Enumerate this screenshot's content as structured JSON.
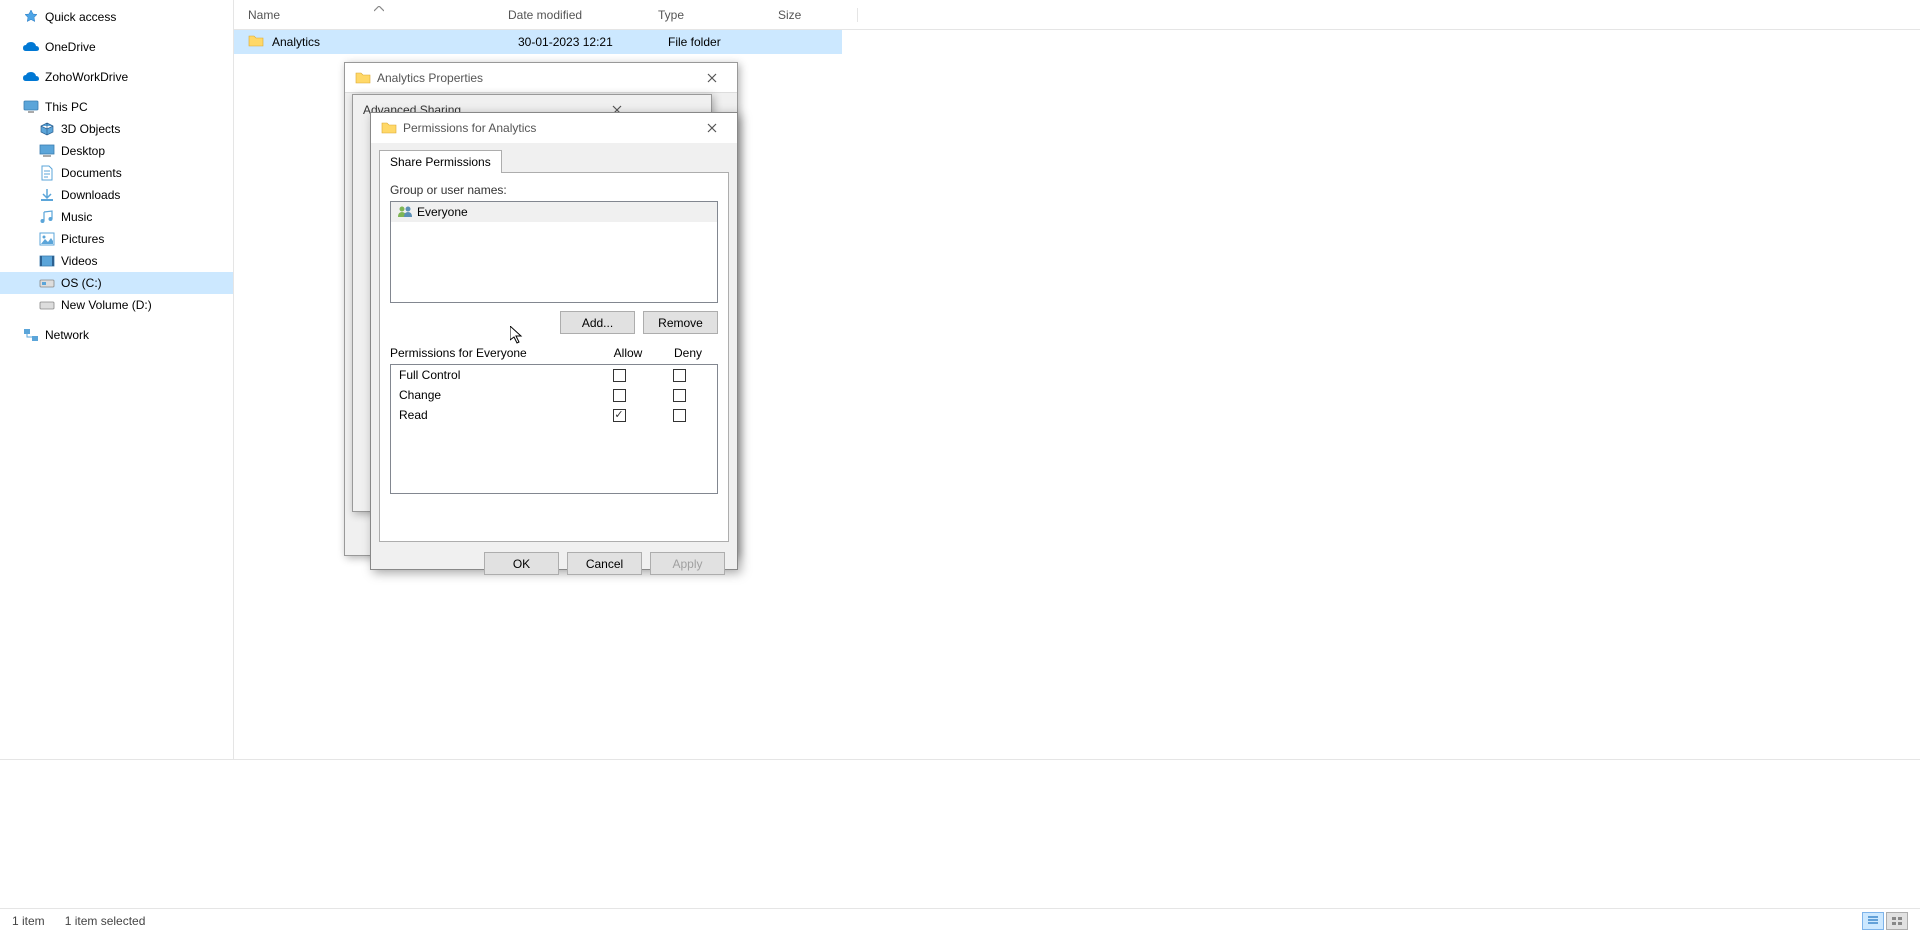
{
  "sidebar": {
    "quick_access": "Quick access",
    "onedrive": "OneDrive",
    "zohoworkdrive": "ZohoWorkDrive",
    "this_pc": "This PC",
    "children": [
      "3D Objects",
      "Desktop",
      "Documents",
      "Downloads",
      "Music",
      "Pictures",
      "Videos",
      "OS (C:)",
      "New Volume (D:)"
    ],
    "network": "Network"
  },
  "columns": {
    "name": "Name",
    "date": "Date modified",
    "type": "Type",
    "size": "Size"
  },
  "file": {
    "name": "Analytics",
    "date": "30-01-2023 12:21",
    "type": "File folder"
  },
  "status": {
    "items": "1 item",
    "selected": "1 item selected"
  },
  "dialog_props": {
    "title": "Analytics Properties"
  },
  "dialog_adv": {
    "title": "Advanced Sharing"
  },
  "dialog_perm": {
    "title": "Permissions for Analytics",
    "tab": "Share Permissions",
    "group_label": "Group or user names:",
    "users": [
      "Everyone"
    ],
    "add_btn": "Add...",
    "remove_btn": "Remove",
    "perm_for": "Permissions for Everyone",
    "allow": "Allow",
    "deny": "Deny",
    "permissions": [
      {
        "name": "Full Control",
        "allow": false,
        "deny": false
      },
      {
        "name": "Change",
        "allow": false,
        "deny": false
      },
      {
        "name": "Read",
        "allow": true,
        "deny": false
      }
    ],
    "ok": "OK",
    "cancel": "Cancel",
    "apply": "Apply"
  }
}
